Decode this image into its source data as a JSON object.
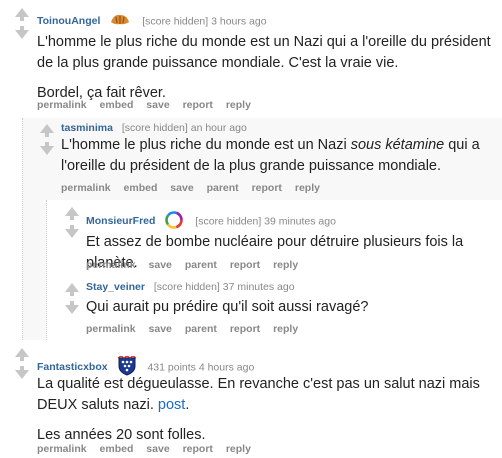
{
  "comments": [
    {
      "author": "ToinouAngel",
      "meta": "[score hidden] 3 hours ago",
      "body": [
        "L'homme le plus riche du monde est un Nazi qui a l'oreille du président de la plus grande puissance mondiale. C'est la vraie vie.",
        "Bordel, ça fait rêver."
      ],
      "buttons": [
        "permalink",
        "embed",
        "save",
        "report",
        "reply"
      ]
    },
    {
      "author": "tasminima",
      "meta": "[score hidden] an hour ago",
      "body_pre": "L'homme le plus riche du monde est un Nazi ",
      "body_em": "sous kétamine",
      "body_post": " qui a l'oreille du président de la plus grande puissance mondiale.",
      "buttons": [
        "permalink",
        "embed",
        "save",
        "parent",
        "report",
        "reply"
      ]
    },
    {
      "author": "MonsieurFred",
      "meta": "[score hidden] 39 minutes ago",
      "body": "Et assez de bombe nucléaire pour détruire plusieurs fois la planète.",
      "buttons": [
        "permalink",
        "save",
        "parent",
        "report",
        "reply"
      ]
    },
    {
      "author": "Stay_veiner",
      "meta": "[score hidden] 37 minutes ago",
      "body": "Qui aurait pu prédire qu'il soit aussi ravagé?",
      "buttons": [
        "permalink",
        "save",
        "parent",
        "report",
        "reply"
      ]
    },
    {
      "author": "Fantasticxbox",
      "meta": "431 points 4 hours ago",
      "body_pre": "La qualité est dégueulasse. En revanche c'est pas un salut nazi mais DEUX saluts nazi. ",
      "body_link": "post",
      "body_post": ".",
      "body2": "Les années 20 sont folles.",
      "buttons": [
        "permalink",
        "embed",
        "save",
        "report",
        "reply"
      ]
    }
  ],
  "icons": {
    "vote_up": "upvote-arrow-icon",
    "vote_down": "downvote-arrow-icon",
    "flair_1": "croissant-flair-icon",
    "flair_3": "rainbow-ring-flair-icon",
    "flair_5": "heraldic-shield-flair-icon"
  },
  "colors": {
    "author": "#336699",
    "meta": "#888888",
    "link": "#1b6ac9",
    "arrow": "#c6c6c6",
    "child_bg": "#f8f8f8"
  }
}
